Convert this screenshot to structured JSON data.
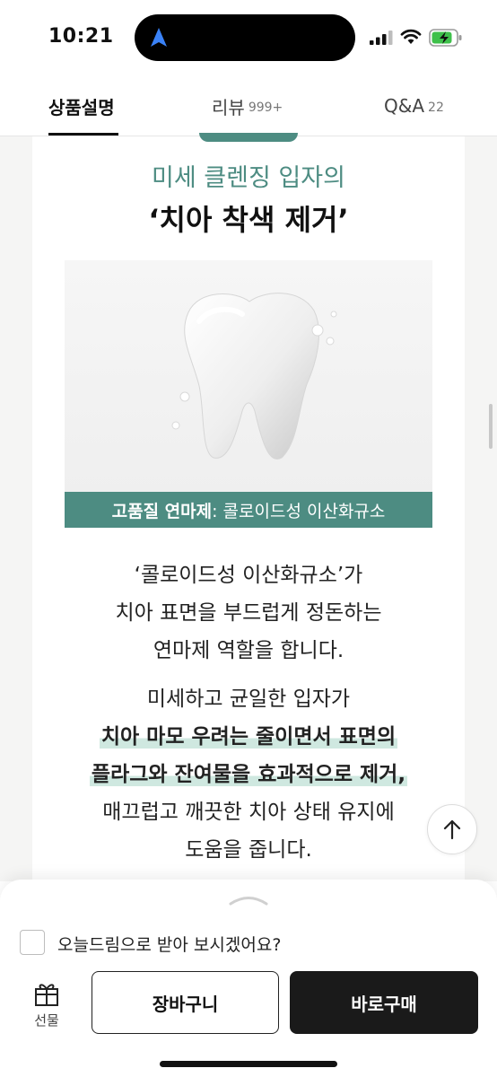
{
  "status_bar": {
    "time": "10:21",
    "battery_color": "#3ec04a"
  },
  "tabs": [
    {
      "label": "상품설명",
      "count": "",
      "active": true
    },
    {
      "label": "리뷰",
      "count": "999+",
      "active": false
    },
    {
      "label": "Q&A",
      "count": "22",
      "active": false
    }
  ],
  "content": {
    "subtitle": "미세 클렌징 입자의",
    "headline": "‘치아 착색 제거’",
    "band": {
      "strong": "고품질 연마제",
      "rest": " : 콜로이드성 이산화규소"
    },
    "paragraph1": [
      "‘콜로이드성 이산화규소’가",
      "치아 표면을 부드럽게 정돈하는",
      "연마제 역할을 합니다."
    ],
    "paragraph2": {
      "line1": "미세하고 균일한 입자가",
      "highlight1": "치아 마모 우려는 줄이면서 표면의",
      "highlight2": "플라그와 잔여물을 효과적으로 제거,",
      "line4": "매끄럽고 깨끗한 치아 상태 유지에",
      "line5": "도움을 줍니다."
    },
    "accent_color": "#4d8c82"
  },
  "bottom_sheet": {
    "gift_question": "오늘드림으로 받아 보시겠어요?",
    "gift_checked": false,
    "gift_label": "선물",
    "cart_label": "장바구니",
    "buy_label": "바로구매"
  }
}
